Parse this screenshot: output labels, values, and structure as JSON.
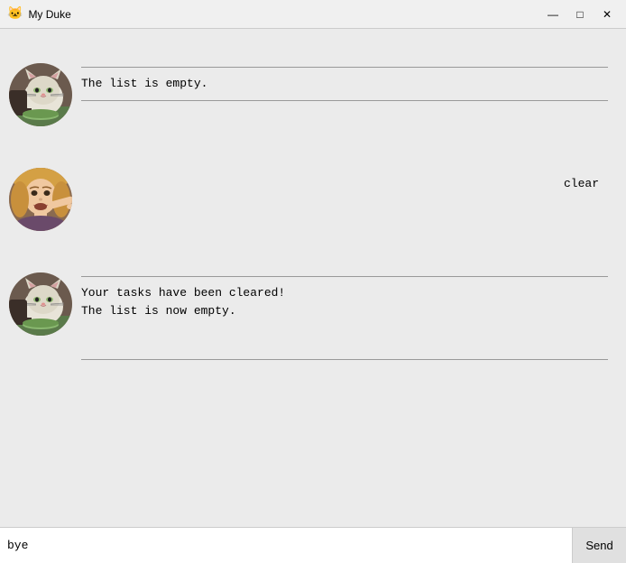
{
  "window": {
    "title": "My Duke",
    "icon": "🐱"
  },
  "titlebar": {
    "minimize": "—",
    "maximize": "□",
    "close": "✕"
  },
  "messages": [
    {
      "id": "msg1",
      "type": "bot",
      "divider_top": true,
      "divider_bottom": true,
      "text": "The list is empty."
    },
    {
      "id": "msg2",
      "type": "user",
      "text": "clear"
    },
    {
      "id": "msg3",
      "type": "bot",
      "divider_top": true,
      "divider_bottom": true,
      "text": "Your tasks have been cleared!\nThe list is now empty."
    }
  ],
  "input": {
    "value": "bye",
    "placeholder": ""
  },
  "send_button": "Send"
}
